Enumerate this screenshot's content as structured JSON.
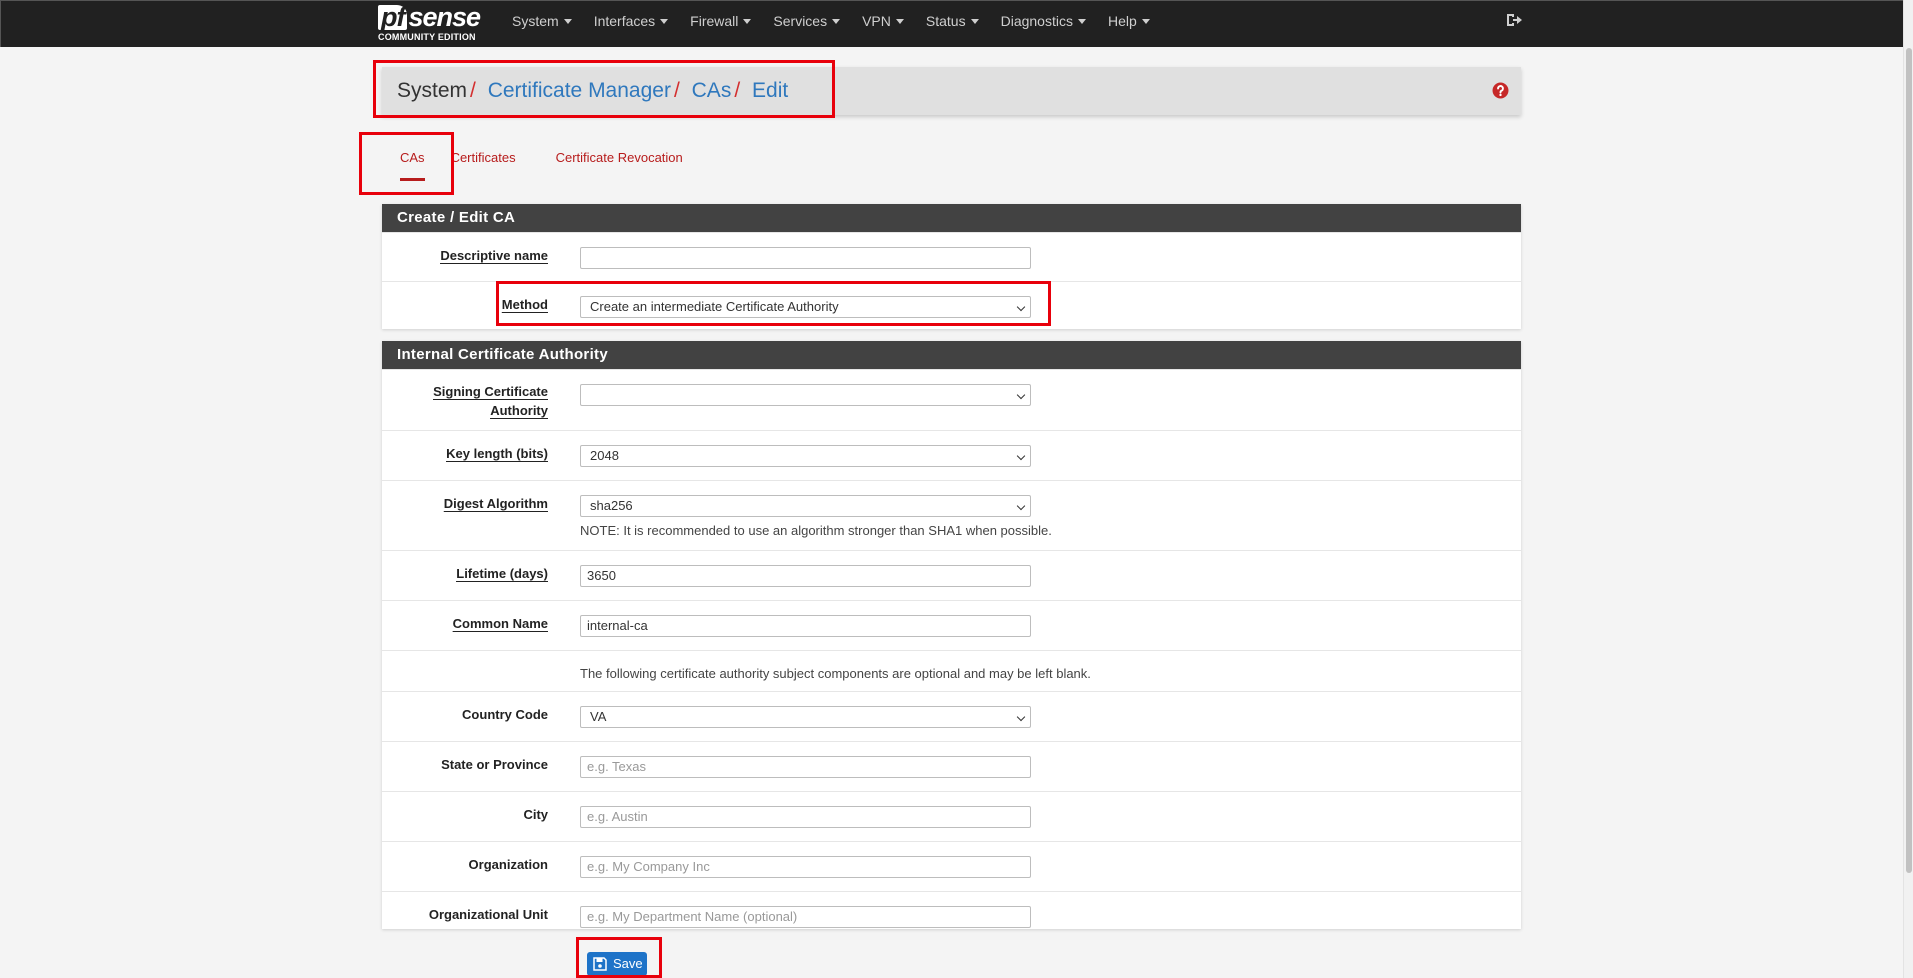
{
  "navbar": {
    "brand": {
      "logo_pf": "pf",
      "logo_sense": "sense",
      "edition": "COMMUNITY EDITION"
    },
    "menu": [
      {
        "label": "System"
      },
      {
        "label": "Interfaces"
      },
      {
        "label": "Firewall"
      },
      {
        "label": "Services"
      },
      {
        "label": "VPN"
      },
      {
        "label": "Status"
      },
      {
        "label": "Diagnostics"
      },
      {
        "label": "Help"
      }
    ]
  },
  "breadcrumb": {
    "items": [
      "System",
      "Certificate Manager",
      "CAs",
      "Edit"
    ],
    "separator": "/"
  },
  "tabs": [
    {
      "label": "CAs",
      "active": true
    },
    {
      "label": "Certificates",
      "active": false
    },
    {
      "label": "Certificate Revocation",
      "active": false
    }
  ],
  "create_edit_panel": {
    "heading": "Create / Edit CA",
    "descriptive_name": {
      "label": "Descriptive name",
      "value": ""
    },
    "method": {
      "label": "Method",
      "value": "Create an intermediate Certificate Authority"
    }
  },
  "internal_ca_panel": {
    "heading": "Internal Certificate Authority",
    "signing_ca": {
      "label_line1": "Signing Certificate",
      "label_line2": "Authority",
      "value": ""
    },
    "key_length": {
      "label": "Key length (bits)",
      "value": "2048"
    },
    "digest": {
      "label": "Digest Algorithm",
      "value": "sha256",
      "note": "NOTE: It is recommended to use an algorithm stronger than SHA1 when possible."
    },
    "lifetime": {
      "label": "Lifetime (days)",
      "value": "3650"
    },
    "common_name": {
      "label": "Common Name",
      "value": "internal-ca"
    },
    "optional_note": "The following certificate authority subject components are optional and may be left blank.",
    "country": {
      "label": "Country Code",
      "value": "VA"
    },
    "state": {
      "label": "State or Province",
      "placeholder": "e.g. Texas"
    },
    "city": {
      "label": "City",
      "placeholder": "e.g. Austin"
    },
    "organization": {
      "label": "Organization",
      "placeholder": "e.g. My Company Inc"
    },
    "org_unit": {
      "label": "Organizational Unit",
      "placeholder": "e.g. My Department Name (optional)"
    }
  },
  "save": {
    "label": "Save"
  },
  "colors": {
    "navbar_bg": "#212121",
    "panel_heading_bg": "#424242",
    "link_blue": "#2f78bd",
    "tab_red": "#b71c1c",
    "save_blue": "#1e73c8",
    "annotation_red": "#e8000b"
  },
  "icons": {
    "logout": "sign-out-icon",
    "help": "question-circle-icon",
    "save": "floppy-disk-icon"
  }
}
